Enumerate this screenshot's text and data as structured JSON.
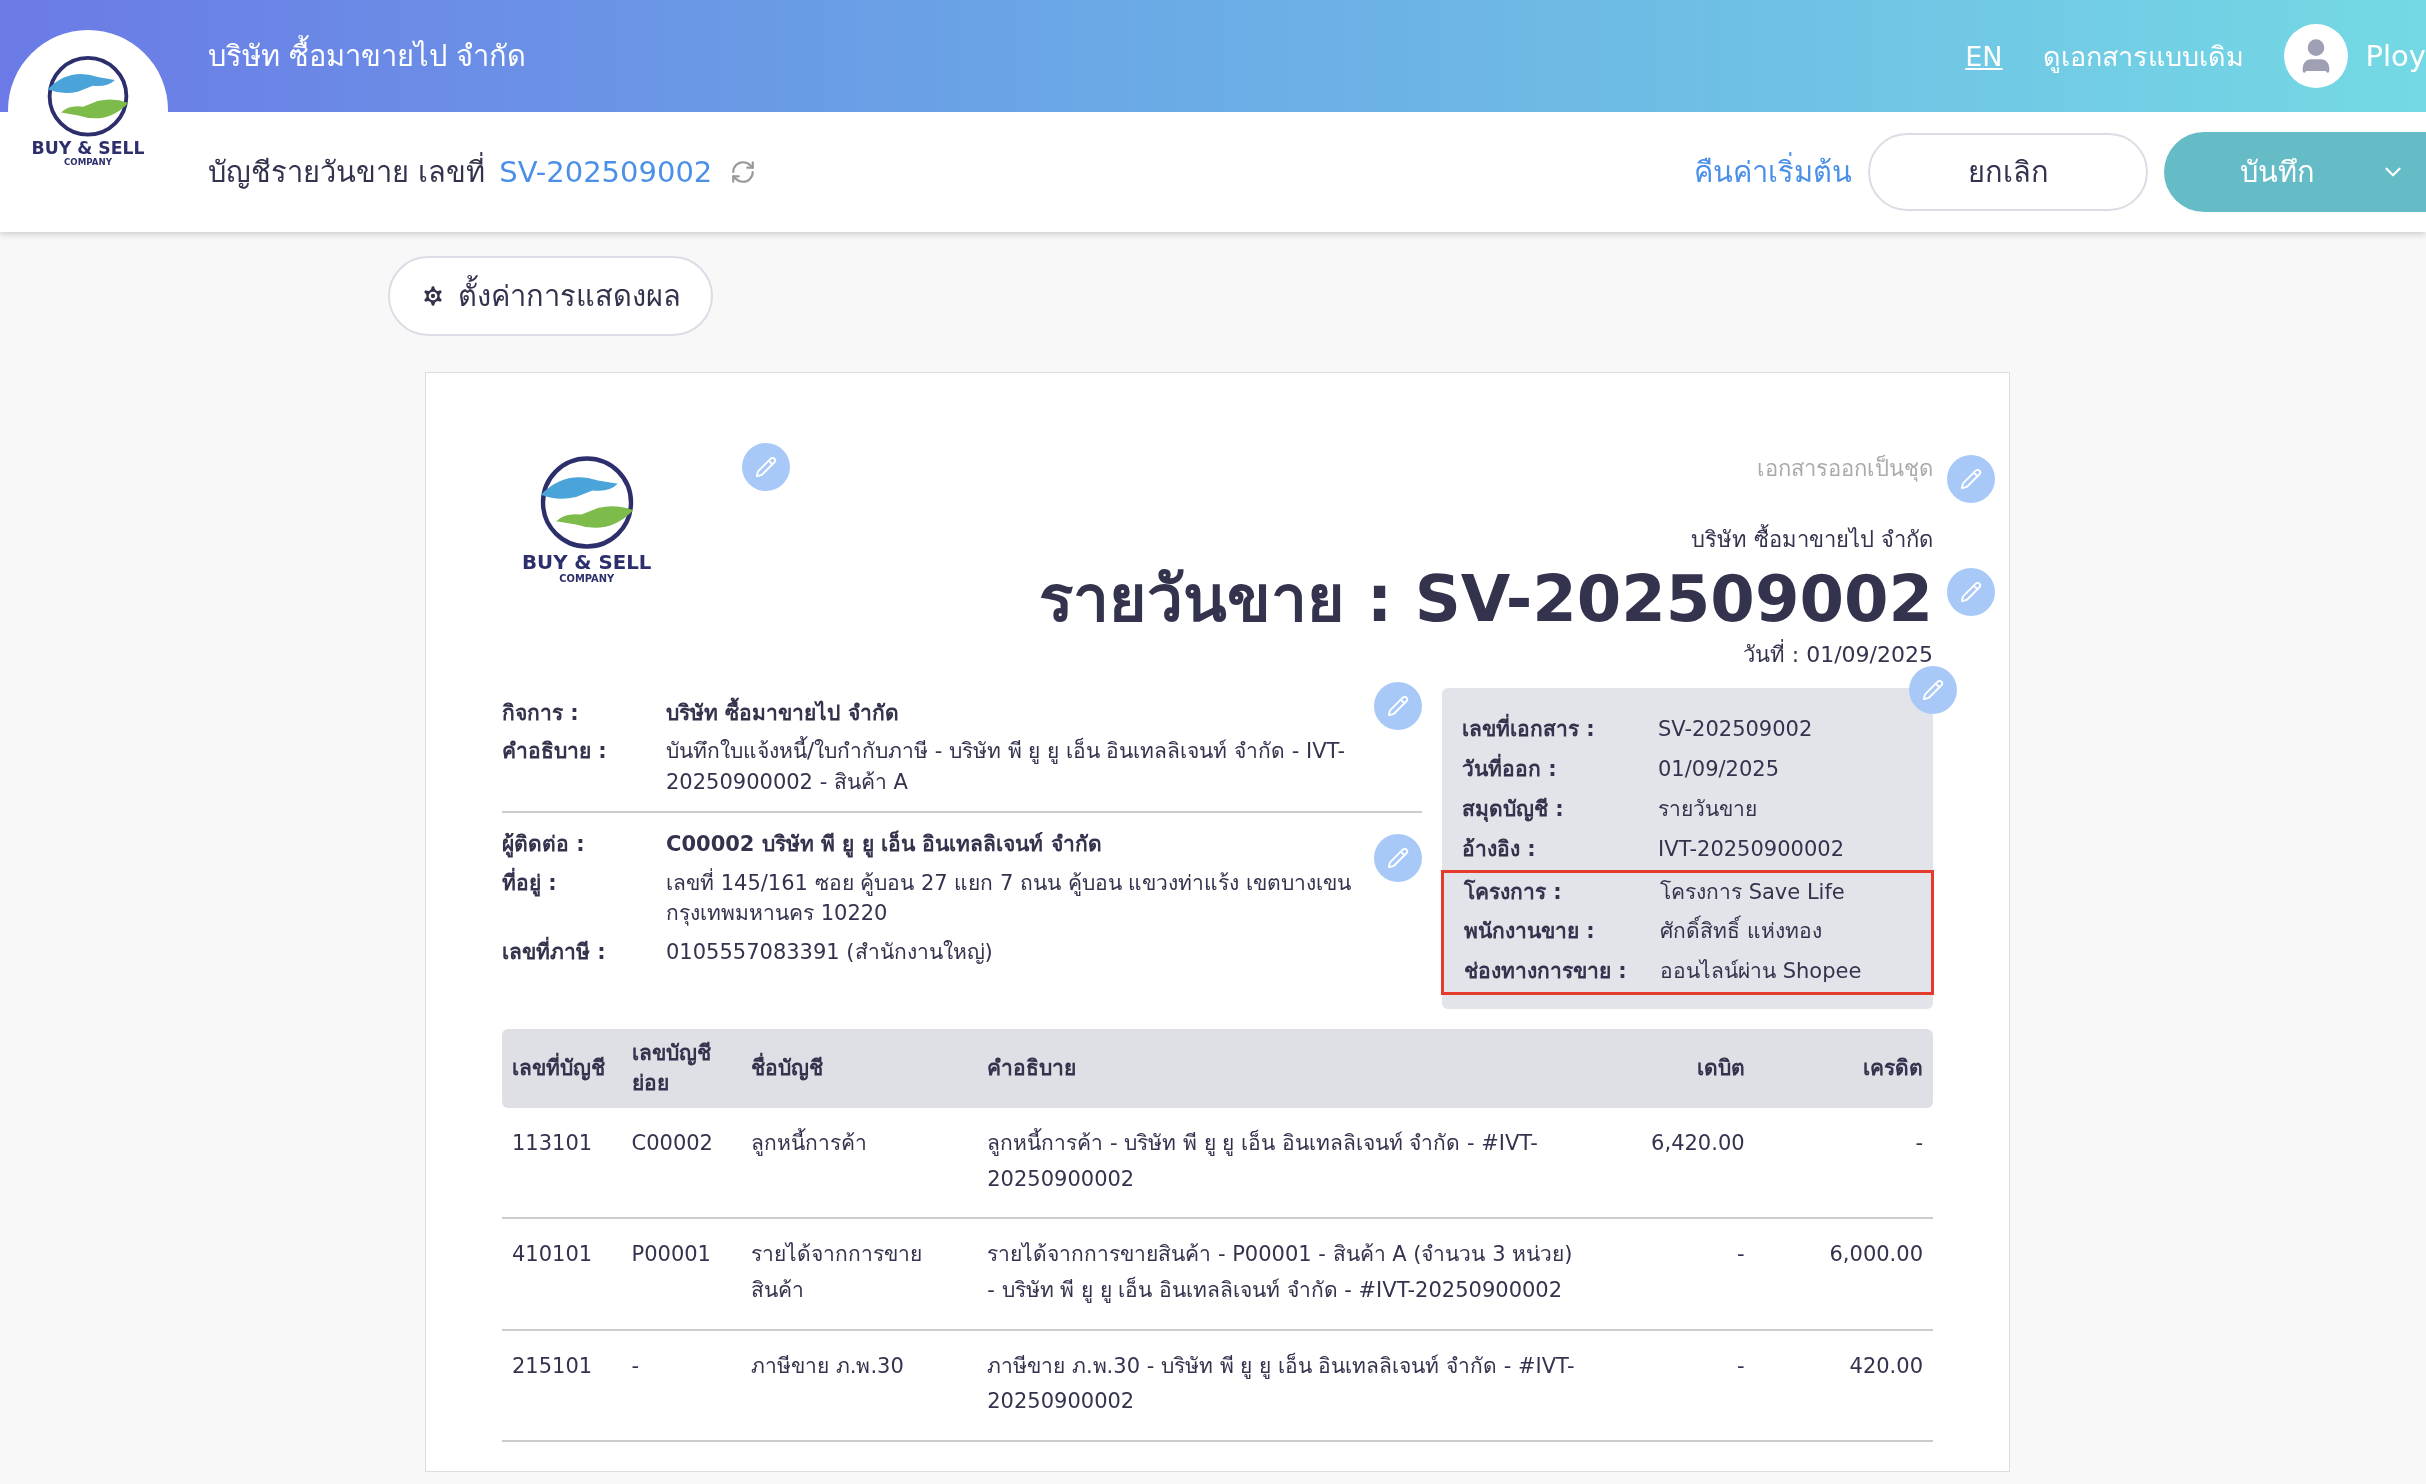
{
  "header": {
    "logo": {
      "name": "BUY & SELL",
      "sub": "COMPANY"
    },
    "company": "บริษัท ซื้อมาขายไป จำกัด",
    "language": "EN",
    "classic_view": "ดูเอกสารแบบเดิม",
    "user": "Ploy"
  },
  "toolbar": {
    "doc_label": "บัญชีรายวันขาย เลขที่",
    "doc_number": "SV-202509002",
    "reset": "คืนค่าเริ่มต้น",
    "cancel": "ยกเลิก",
    "save": "บันทึก"
  },
  "display_settings": "ตั้งค่าการแสดงผล",
  "document": {
    "logo": {
      "name": "BUY & SELL",
      "sub": "COMPANY"
    },
    "copy_note": "เอกสารออกเป็นชุด",
    "company": "บริษัท ซื้อมาขายไป จำกัด",
    "title": "รายวันขาย : SV-202509002",
    "date": "วันที่ : 01/09/2025",
    "business": [
      {
        "label": "กิจการ :",
        "value": "บริษัท ซื้อมาขายไป จำกัด",
        "bold": true
      },
      {
        "label": "คำอธิบาย :",
        "value": "บันทึกใบแจ้งหนี้/ใบกำกับภาษี - บริษัท พี ยู ยู เอ็น อินเทลลิเจนท์ จำกัด - IVT-20250900002 - สินค้า A",
        "bold": false
      }
    ],
    "contact": [
      {
        "label": "ผู้ติดต่อ :",
        "value": "C00002 บริษัท พี ยู ยู เอ็น อินเทลลิเจนท์ จำกัด",
        "bold": true
      },
      {
        "label": "ที่อยู่ :",
        "value": "เลขที่ 145/161     ซอย คู้บอน 27 แยก 7 ถนน คู้บอน  แขวงท่าแร้ง เขตบางเขน กรุงเทพมหานคร 10220",
        "bold": false
      },
      {
        "label": "เลขที่ภาษี :",
        "value": "0105557083391 (สำนักงานใหญ่)",
        "bold": false
      }
    ],
    "info": [
      {
        "label": "เลขที่เอกสาร :",
        "value": "SV-202509002",
        "highlighted": false
      },
      {
        "label": "วันที่ออก :",
        "value": "01/09/2025",
        "highlighted": false
      },
      {
        "label": "สมุดบัญชี :",
        "value": "รายวันขาย",
        "highlighted": false
      },
      {
        "label": "อ้างอิง :",
        "value": "IVT-20250900002",
        "highlighted": false
      },
      {
        "label": "โครงการ :",
        "value": "โครงการ Save Life",
        "highlighted": true
      },
      {
        "label": "พนักงานขาย :",
        "value": "ศักดิ์สิทธิ์ แห่งทอง",
        "highlighted": true
      },
      {
        "label": "ช่องทางการขาย :",
        "value": "ออนไลน์ผ่าน Shopee",
        "highlighted": true
      }
    ],
    "table": {
      "columns": [
        "เลขที่บัญชี",
        "เลขบัญชีย่อย",
        "ชื่อบัญชี",
        "คำอธิบาย",
        "เดบิต",
        "เครดิต"
      ],
      "rows": [
        [
          "113101",
          "C00002",
          "ลูกหนี้การค้า",
          "ลูกหนี้การค้า - บริษัท พี ยู ยู เอ็น อินเทลลิเจนท์ จำกัด - #IVT-20250900002",
          "6,420.00",
          "-"
        ],
        [
          "410101",
          "P00001",
          "รายได้จากการขายสินค้า",
          "รายได้จากการขายสินค้า - P00001 - สินค้า A (จำนวน 3 หน่วย) - บริษัท พี ยู ยู เอ็น อินเทลลิเจนท์ จำกัด - #IVT-20250900002",
          "-",
          "6,000.00"
        ],
        [
          "215101",
          "-",
          "ภาษีขาย ภ.พ.30",
          "ภาษีขาย ภ.พ.30 - บริษัท พี ยู ยู เอ็น อินเทลลิเจนท์ จำกัด - #IVT-20250900002",
          "-",
          "420.00"
        ]
      ]
    }
  }
}
